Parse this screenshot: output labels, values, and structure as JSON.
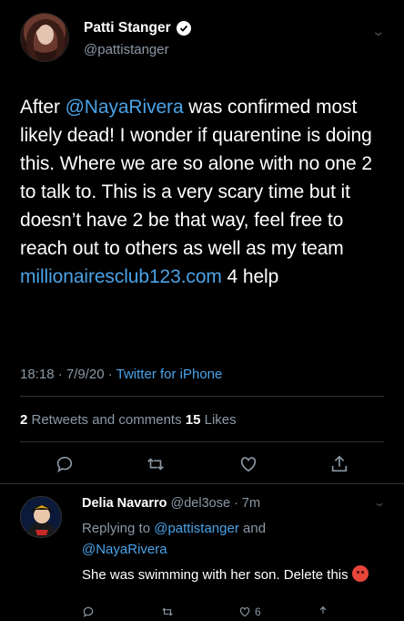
{
  "tweet": {
    "display_name": "Patti Stanger",
    "handle": "@pattistanger",
    "body": {
      "p1": "After ",
      "mention": "@NayaRivera",
      "p2": " was confirmed most likely dead! I wonder if quarentine is doing this. Where we are so alone with no one 2 to talk to. This is a very scary time but it doesn’t have 2 be that way, feel free to reach out to others as well as my team ",
      "link": "millionairesclub123.com",
      "p3": " 4 help"
    },
    "time": "18:18 · 7/9/20 · ",
    "source": "Twitter for iPhone",
    "retweets_count": "2",
    "retweets_label": " Retweets and comments  ",
    "likes_count": "15",
    "likes_label": " Likes"
  },
  "reply": {
    "display_name": "Delia Navarro",
    "handle_time": " @del3ose · 7m",
    "replying_prefix": "Replying to ",
    "replying_to_1": "@pattistanger",
    "replying_and": " and",
    "replying_to_2": "@NayaRivera",
    "text": "She was swimming with her son. Delete this ",
    "likes_count": "6"
  },
  "colors": {
    "background": "#000000",
    "link": "#4aa3e8",
    "secondary_text": "#8b98a5"
  }
}
